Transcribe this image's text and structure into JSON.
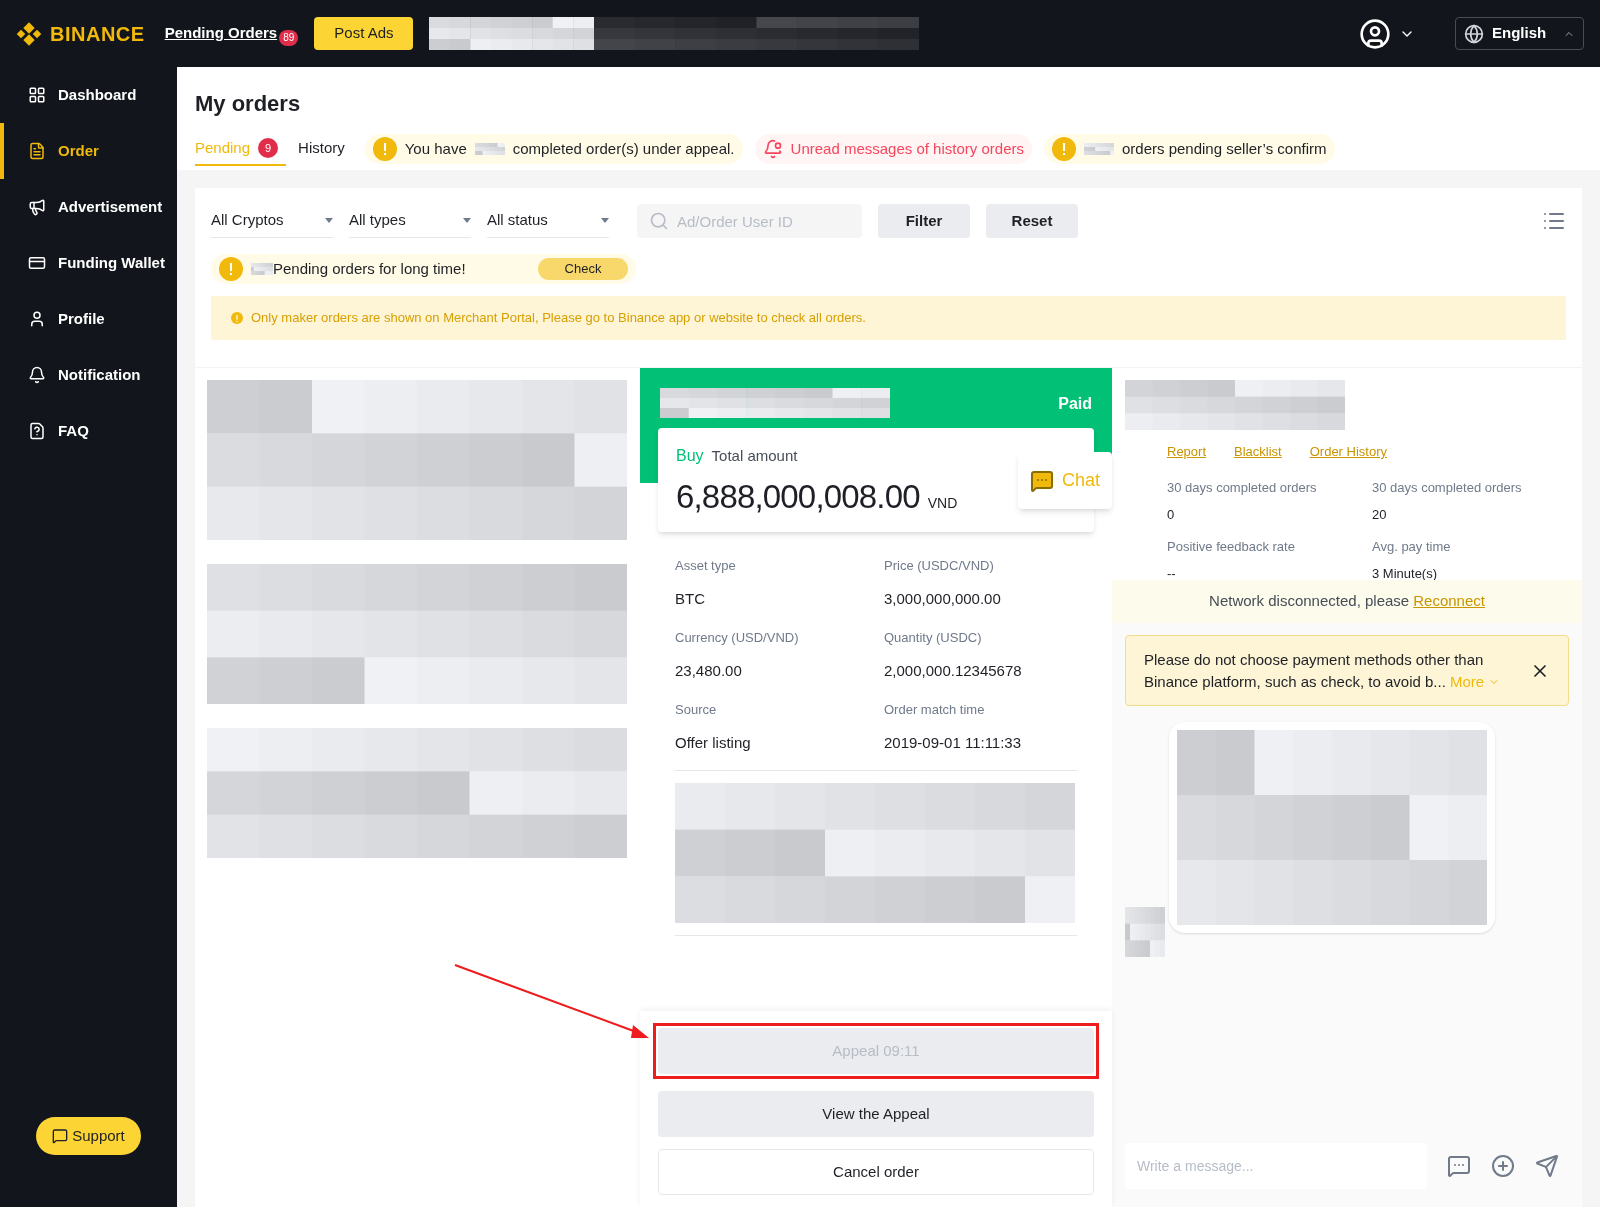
{
  "header": {
    "logo": "BINANCE",
    "pending_orders": "Pending Orders",
    "pending_count": "89",
    "post_ads": "Post Ads",
    "language": "English"
  },
  "sidebar": {
    "items": [
      {
        "label": "Dashboard",
        "selected": false
      },
      {
        "label": "Order",
        "selected": true
      },
      {
        "label": "Advertisement",
        "selected": false
      },
      {
        "label": "Funding Wallet",
        "selected": false
      },
      {
        "label": "Profile",
        "selected": false
      },
      {
        "label": "Notification",
        "selected": false
      },
      {
        "label": "FAQ",
        "selected": false
      }
    ],
    "support": "Support"
  },
  "page": {
    "title": "My orders",
    "tabs": [
      {
        "label": "Pending",
        "badge": "9",
        "selected": true
      },
      {
        "label": "History",
        "selected": false
      }
    ],
    "notices": [
      {
        "kind": "warning",
        "segments": [
          {
            "kind": "text",
            "text": "You have"
          },
          {
            "kind": "redacted"
          },
          {
            "kind": "text",
            "text": "completed order(s) under appeal."
          }
        ]
      },
      {
        "kind": "unread",
        "segments": [
          {
            "kind": "text",
            "text": "Unread messages of history orders"
          }
        ]
      },
      {
        "kind": "warning",
        "segments": [
          {
            "kind": "redacted"
          },
          {
            "kind": "text",
            "text": "orders pending seller’s confirm"
          }
        ]
      }
    ]
  },
  "filters": {
    "selects": [
      "All Cryptos",
      "All types",
      "All status"
    ],
    "search_placeholder": "Ad/Order User ID",
    "buttons": [
      "Filter",
      "Reset"
    ],
    "long_pending": {
      "text": "Pending orders for long time!",
      "button": "Check"
    },
    "info": "Only maker orders are shown on Merchant Portal, Please go to Binance app or website to check all orders."
  },
  "order": {
    "status": "Paid",
    "side": "Buy",
    "total_label": "Total amount",
    "amount": "6,888,000,008.00",
    "currency": "VND",
    "chat": "Chat",
    "details": [
      {
        "label": "Asset type",
        "value": "BTC"
      },
      {
        "label": "Price (USDC/VND)",
        "value": "3,000,000,000.00"
      },
      {
        "label": "Currency (USD/VND)",
        "value": "23,480.00"
      },
      {
        "label": "Quantity (USDC)",
        "value": "2,000,000.12345678"
      },
      {
        "label": "Source",
        "value": "Offer listing"
      },
      {
        "label": "Order match time",
        "value": "2019-09-01 11:11:33"
      }
    ],
    "actions": [
      {
        "label": "Appeal 09:11",
        "kind": "disabled",
        "highlighted": true
      },
      {
        "label": "View the Appeal",
        "kind": "filled",
        "highlighted": false
      },
      {
        "label": "Cancel order",
        "kind": "outline",
        "highlighted": false
      }
    ]
  },
  "counterparty": {
    "links": [
      "Report",
      "Blacklist",
      "Order History"
    ],
    "stats": [
      {
        "label": "30 days completed orders",
        "value": "0"
      },
      {
        "label": "30 days completed orders",
        "value": "20"
      },
      {
        "label": "Positive feedback rate",
        "value": "--"
      },
      {
        "label": "Avg. pay time",
        "value": "3 Minute(s)"
      }
    ],
    "network": {
      "text": "Network disconnected, please",
      "link": "Reconnect"
    },
    "warning": {
      "text": "Please do not choose payment methods other than Binance platform, such as check, to avoid b...",
      "more": "More"
    },
    "message_placeholder": "Write a message..."
  }
}
